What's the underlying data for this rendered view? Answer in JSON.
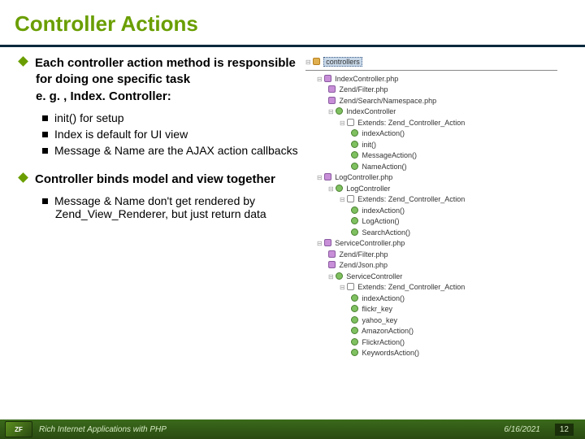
{
  "title": "Controller Actions",
  "left": {
    "b1_main": "Each controller action method is responsible for doing one specific task",
    "b1_sub": "e. g. , Index. Controller:",
    "b1_items": [
      "init() for setup",
      "Index is default for UI view",
      "Message & Name are the AJAX action callbacks"
    ],
    "b2_main": "Controller binds model and view together",
    "b2_items": [
      "Message & Name don't get rendered by Zend_View_Renderer, but just return data"
    ]
  },
  "tree": {
    "root": "controllers",
    "f1": "IndexController.php",
    "f1_u1": "Zend/Filter.php",
    "f1_u2": "Zend/Search/Namespace.php",
    "f1_cls": "IndexController",
    "f1_ext": "Extends: Zend_Controller_Action",
    "f1_m1": "indexAction()",
    "f1_m2": "init()",
    "f1_m3": "MessageAction()",
    "f1_m4": "NameAction()",
    "f2": "LogController.php",
    "f2_cls": "LogController",
    "f2_ext": "Extends: Zend_Controller_Action",
    "f2_m1": "indexAction()",
    "f2_m2": "LogAction()",
    "f2_m3": "SearchAction()",
    "f3": "ServiceController.php",
    "f3_u1": "Zend/Filter.php",
    "f3_u2": "Zend/Json.php",
    "f3_cls": "ServiceController",
    "f3_ext": "Extends: Zend_Controller_Action",
    "f3_m1": "indexAction()",
    "f3_m2": "flickr_key",
    "f3_m3": "yahoo_key",
    "f3_m4": "AmazonAction()",
    "f3_m5": "FlickrAction()",
    "f3_m6": "KeywordsAction()"
  },
  "footer": {
    "logo": "ZF",
    "caption": "Rich Internet Applications with PHP",
    "date": "6/16/2021",
    "page": "12"
  }
}
